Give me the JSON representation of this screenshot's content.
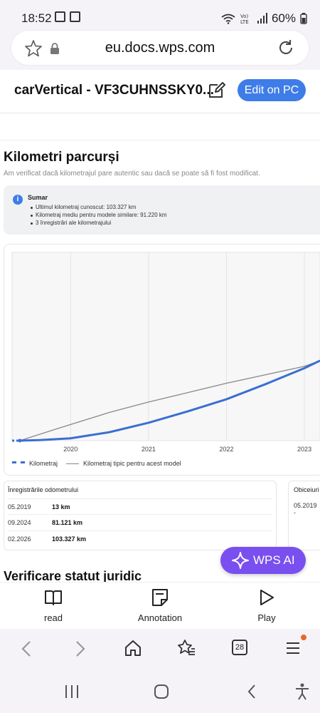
{
  "status": {
    "time": "18:52",
    "battery": "60%"
  },
  "browser": {
    "url": "eu.docs.wps.com"
  },
  "doc": {
    "title": "carVertical - VF3CUHNSSKY0...",
    "edit_label": "Edit on PC"
  },
  "section": {
    "heading": "Kilometri parcurși",
    "subtitle": "Am verificat dacă kilometrajul pare autentic sau dacă se poate să fi fost modificat.",
    "summary_title": "Sumar",
    "summary_items": [
      "Ultimul kilometraj cunoscut: 103.327 km",
      "Kilometraj mediu pentru modele similare: 91.220 km",
      "3 înregistrări ale kilometrajului"
    ]
  },
  "chart_data": {
    "type": "line",
    "x_ticks": [
      "2020",
      "2021",
      "2022",
      "2023"
    ],
    "series": [
      {
        "name": "Kilometraj",
        "style": "dashed",
        "color": "#3a6fd3",
        "points": [
          [
            2019.35,
            13
          ],
          [
            2019.6,
            500
          ],
          [
            2020.0,
            2500
          ],
          [
            2020.5,
            9000
          ],
          [
            2021.0,
            19000
          ],
          [
            2021.5,
            31000
          ],
          [
            2022.0,
            44000
          ],
          [
            2022.5,
            60000
          ],
          [
            2023.0,
            77000
          ],
          [
            2023.2,
            85000
          ]
        ]
      },
      {
        "name": "Kilometraj tipic pentru acest model",
        "style": "solid",
        "color": "#888888",
        "points": [
          [
            2019.35,
            0
          ],
          [
            2019.8,
            12000
          ],
          [
            2020.5,
            30000
          ],
          [
            2021.0,
            41000
          ],
          [
            2021.5,
            51000
          ],
          [
            2022.0,
            61000
          ],
          [
            2022.5,
            70000
          ],
          [
            2023.0,
            79000
          ],
          [
            2023.2,
            85000
          ]
        ]
      }
    ],
    "xlim": [
      2019.25,
      2023.2
    ],
    "ylim": [
      0,
      200000
    ],
    "grid": "vertical",
    "legend": "bottom-left"
  },
  "odometer_table": {
    "header": "Înregistrările odometrului",
    "rows": [
      {
        "date": "05.2019",
        "value": "13 km"
      },
      {
        "date": "09.2024",
        "value": "81.121 km"
      },
      {
        "date": "02.2026",
        "value": "103.327 km"
      }
    ]
  },
  "side_table": {
    "header": "Obiceiuri",
    "value": "05.2019 -"
  },
  "next_heading": "Verificare statut juridic",
  "wps_ai_label": "WPS AI",
  "doc_toolbar": {
    "read": "read",
    "annotation": "Annotation",
    "play": "Play"
  },
  "browser_nav": {
    "tabs_count": "28"
  },
  "colors": {
    "accent": "#3e7de8",
    "wps_ai": "#7a4ff0",
    "notify_dot": "#e8682a"
  }
}
